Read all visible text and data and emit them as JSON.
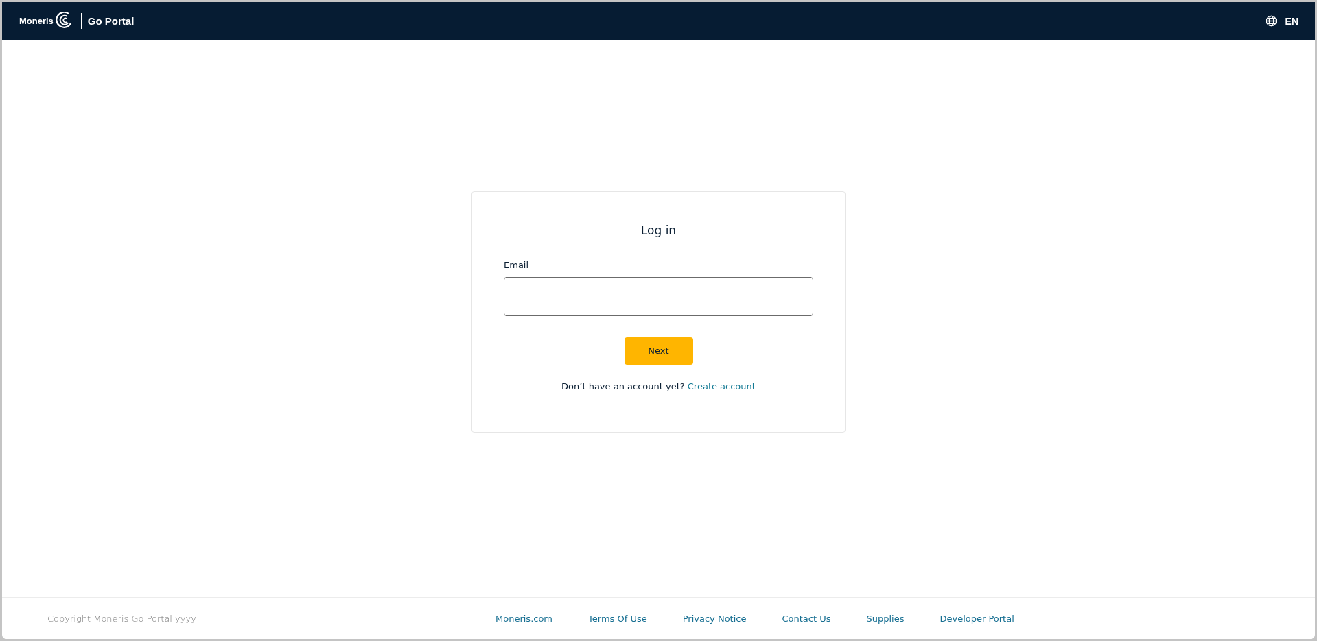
{
  "header": {
    "brand": "Moneris",
    "product": "Go Portal",
    "language": "EN"
  },
  "login": {
    "title": "Log in",
    "email_label": "Email",
    "next_button": "Next",
    "signup_prompt": "Don’t have an account yet?",
    "signup_link": "Create account"
  },
  "footer": {
    "copyright": "Copyright Moneris Go Portal  yyyy",
    "links": [
      "Moneris.com",
      "Terms Of Use",
      "Privacy Notice",
      "Contact Us",
      "Supplies",
      "Developer Portal"
    ]
  }
}
